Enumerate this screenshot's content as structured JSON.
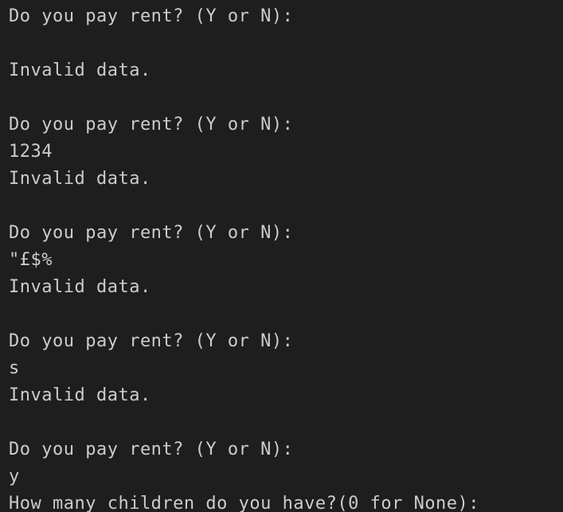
{
  "terminal": {
    "background": "#1e1e1e",
    "foreground": "#cccccc",
    "lines": [
      "Do you pay rent? (Y or N):",
      "",
      "Invalid data.",
      "",
      "Do you pay rent? (Y or N):",
      "1234",
      "Invalid data.",
      "",
      "Do you pay rent? (Y or N):",
      "\"£$%",
      "Invalid data.",
      "",
      "Do you pay rent? (Y or N):",
      "s",
      "Invalid data.",
      "",
      "Do you pay rent? (Y or N):",
      "y",
      "How many children do you have?(0 for None):"
    ]
  }
}
